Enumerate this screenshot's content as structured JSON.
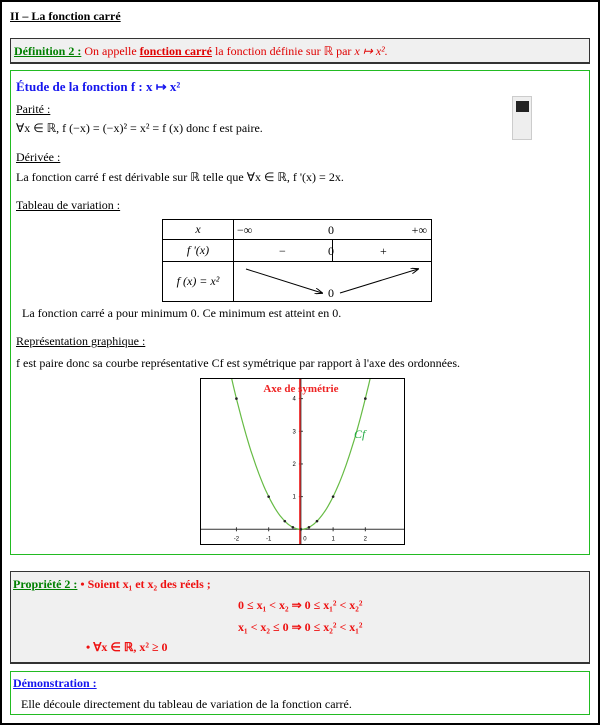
{
  "title": "II – La fonction carré",
  "definition": {
    "label": "Définition 2 :",
    "text1": " On appelle ",
    "term": "fonction carré",
    "text2": " la fonction définie sur ℝ  par  ",
    "formula": "x ↦ x²."
  },
  "etude": {
    "heading": "Étude de la fonction  f : x ↦ x²",
    "parite_label": "Parité :",
    "parite_text": "∀x ∈ ℝ, f (−x) = (−x)² = x² = f (x)  donc  f  est paire.",
    "derivee_label": "Dérivée :",
    "derivee_text": "La fonction carré  f  est dérivable sur ℝ telle que  ∀x ∈ ℝ, f '(x) = 2x.",
    "tableau_label": "Tableau de variation :",
    "table": {
      "row1": [
        "x",
        "−∞",
        "0",
        "+∞"
      ],
      "row2": [
        "f '(x)",
        "−",
        "0",
        "+"
      ],
      "row3": [
        "f (x) = x²",
        "0"
      ]
    },
    "minimum_text": "La fonction carré a pour minimum 0. Ce minimum est atteint en 0.",
    "repr_label": "Représentation graphique :",
    "repr_text": "f  est paire donc sa courbe représentative Cf  est symétrique par rapport à l'axe des ordonnées.",
    "calculator_icon": "calculator-icon"
  },
  "chart_data": {
    "type": "line",
    "function": "x^2",
    "points": [
      [
        -2,
        4
      ],
      [
        -1,
        1
      ],
      [
        -0.5,
        0.25
      ],
      [
        -0.25,
        0.0625
      ],
      [
        0,
        0
      ],
      [
        0.25,
        0.0625
      ],
      [
        0.5,
        0.25
      ],
      [
        1,
        1
      ],
      [
        2,
        4
      ]
    ],
    "xlim": [
      -3.1,
      3.2
    ],
    "ylim": [
      -0.45,
      4.6
    ],
    "xticks": [
      -2,
      -1,
      0,
      1,
      2
    ],
    "yticks": [
      1,
      2,
      3,
      4
    ],
    "xtick_labels": [
      "-2",
      "-1",
      "0",
      "1",
      "2"
    ],
    "ytick_labels": [
      "1",
      "2",
      "3",
      "4"
    ],
    "curve_label": "Cf",
    "annotation": "Axe de symétrie",
    "curve_color": "#66bb44",
    "axis_symmetry_color": "#ee2222",
    "grid": false
  },
  "propriete": {
    "label": "Propriété 2 :",
    "line1": " • Soient  x₁  et x₂  des réels ;",
    "line2": "0 ≤ x₁ < x₂ ⇒ 0 ≤ x₁² < x₂²",
    "line3": "x₁ < x₂ ≤ 0 ⇒ 0 ≤ x₂² < x₁²",
    "line4": "•  ∀x ∈ ℝ, x² ≥ 0"
  },
  "demonstration": {
    "label": "Démonstration :",
    "text": "Elle découle directement du tableau de variation de la fonction carré."
  }
}
